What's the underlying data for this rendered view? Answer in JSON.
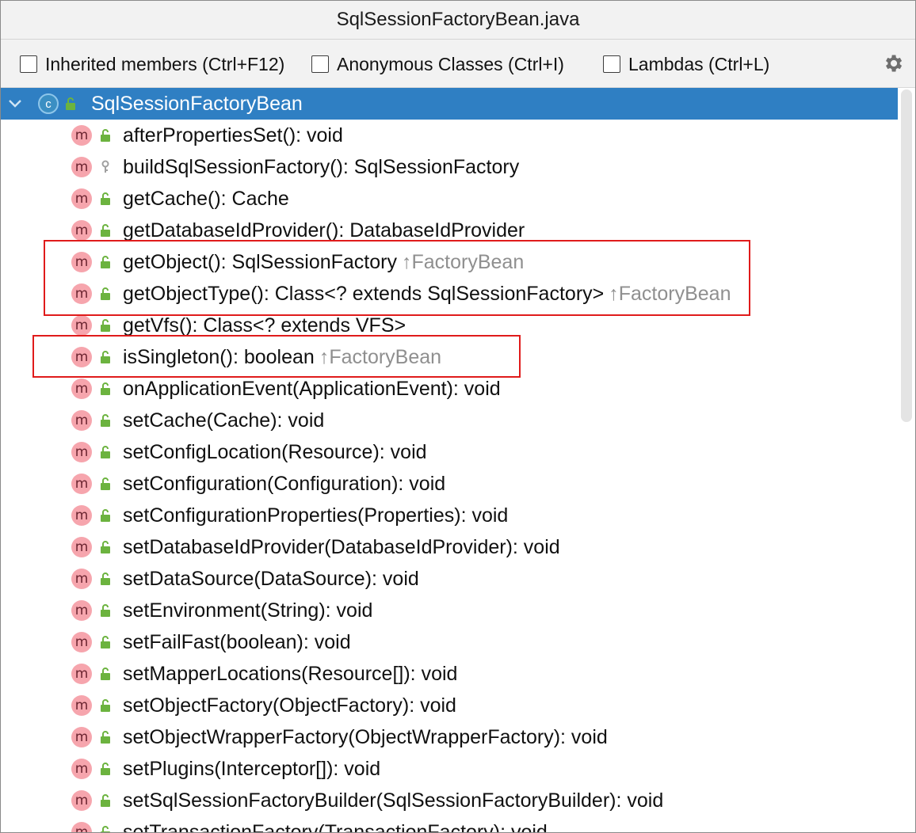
{
  "window": {
    "title": "SqlSessionFactoryBean.java"
  },
  "toolbar": {
    "inherited_label": "Inherited members (Ctrl+F12)",
    "anonymous_label": "Anonymous Classes (Ctrl+I)",
    "lambdas_label": "Lambdas (Ctrl+L)",
    "settings_icon": "gear-icon"
  },
  "tree": {
    "root": {
      "label": "SqlSessionFactoryBean",
      "icon": "class-icon",
      "expanded": true
    },
    "members": [
      {
        "label": "afterPropertiesSet(): void",
        "inherited": "",
        "visibility": "public"
      },
      {
        "label": "buildSqlSessionFactory(): SqlSessionFactory",
        "inherited": "",
        "visibility": "protected"
      },
      {
        "label": "getCache(): Cache",
        "inherited": "",
        "visibility": "public"
      },
      {
        "label": "getDatabaseIdProvider(): DatabaseIdProvider",
        "inherited": "",
        "visibility": "public"
      },
      {
        "label": "getObject(): SqlSessionFactory",
        "inherited": "↑FactoryBean",
        "visibility": "public"
      },
      {
        "label": "getObjectType(): Class<? extends SqlSessionFactory>",
        "inherited": "↑FactoryBean",
        "visibility": "public"
      },
      {
        "label": "getVfs(): Class<? extends VFS>",
        "inherited": "",
        "visibility": "public"
      },
      {
        "label": "isSingleton(): boolean",
        "inherited": "↑FactoryBean",
        "visibility": "public"
      },
      {
        "label": "onApplicationEvent(ApplicationEvent): void",
        "inherited": "",
        "visibility": "public"
      },
      {
        "label": "setCache(Cache): void",
        "inherited": "",
        "visibility": "public"
      },
      {
        "label": "setConfigLocation(Resource): void",
        "inherited": "",
        "visibility": "public"
      },
      {
        "label": "setConfiguration(Configuration): void",
        "inherited": "",
        "visibility": "public"
      },
      {
        "label": "setConfigurationProperties(Properties): void",
        "inherited": "",
        "visibility": "public"
      },
      {
        "label": "setDatabaseIdProvider(DatabaseIdProvider): void",
        "inherited": "",
        "visibility": "public"
      },
      {
        "label": "setDataSource(DataSource): void",
        "inherited": "",
        "visibility": "public"
      },
      {
        "label": "setEnvironment(String): void",
        "inherited": "",
        "visibility": "public"
      },
      {
        "label": "setFailFast(boolean): void",
        "inherited": "",
        "visibility": "public"
      },
      {
        "label": "setMapperLocations(Resource[]): void",
        "inherited": "",
        "visibility": "public"
      },
      {
        "label": "setObjectFactory(ObjectFactory): void",
        "inherited": "",
        "visibility": "public"
      },
      {
        "label": "setObjectWrapperFactory(ObjectWrapperFactory): void",
        "inherited": "",
        "visibility": "public"
      },
      {
        "label": "setPlugins(Interceptor[]): void",
        "inherited": "",
        "visibility": "public"
      },
      {
        "label": "setSqlSessionFactoryBuilder(SqlSessionFactoryBuilder): void",
        "inherited": "",
        "visibility": "public"
      },
      {
        "label": "setTransactionFactory(TransactionFactory): void",
        "inherited": "",
        "visibility": "public"
      }
    ]
  },
  "icons": {
    "method": "m",
    "class": "c"
  },
  "colors": {
    "selection": "#2f7fc3",
    "highlight_box": "#e01b1b",
    "method_icon": "#f6a5ad",
    "public_lock": "#6cb33f"
  }
}
